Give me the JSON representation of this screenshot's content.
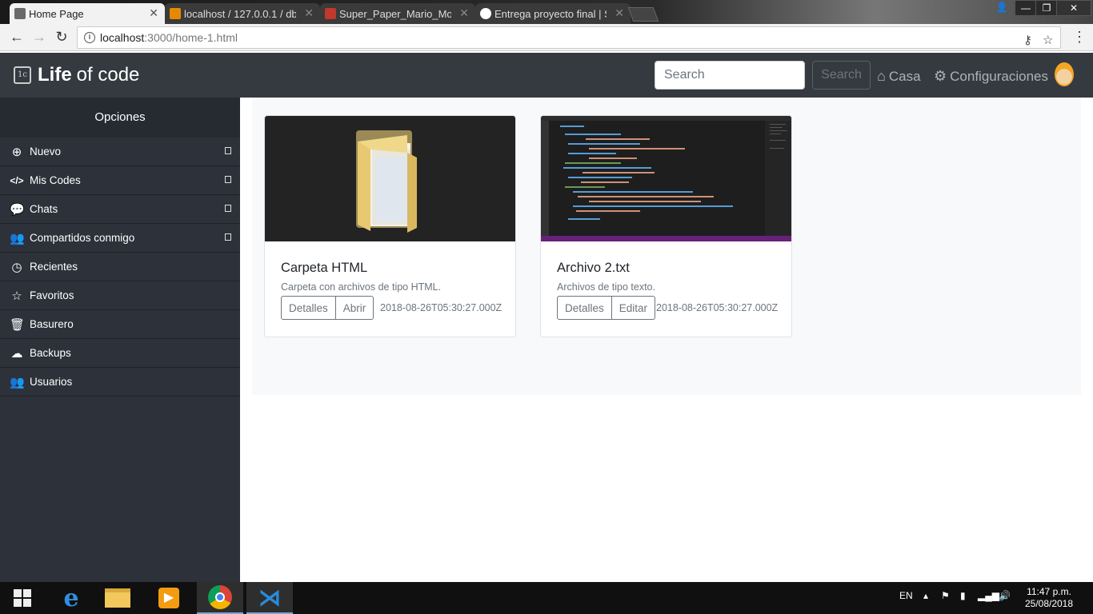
{
  "browser": {
    "tabs": [
      {
        "title": "Home Page",
        "active": true
      },
      {
        "title": "localhost / 127.0.0.1 / db",
        "active": false
      },
      {
        "title": "Super_Paper_Mario_MoP",
        "active": false
      },
      {
        "title": "Entrega proyecto final | S",
        "active": false
      }
    ],
    "url_host": "localhost",
    "url_path": ":3000/home-1.html"
  },
  "header": {
    "brand_bold": "Life",
    "brand_rest": "of code",
    "logo_text": "1c",
    "search_placeholder": "Search",
    "search_button": "Search",
    "nav_home": "Casa",
    "nav_settings": "Configuraciones"
  },
  "sidebar": {
    "title": "Opciones",
    "items": [
      {
        "label": "Nuevo",
        "icon": "plus-circle-icon",
        "expandable": true
      },
      {
        "label": "Mis Codes",
        "icon": "code-icon",
        "expandable": true
      },
      {
        "label": "Chats",
        "icon": "chat-icon",
        "expandable": true
      },
      {
        "label": "Compartidos conmigo",
        "icon": "users-icon",
        "expandable": true
      },
      {
        "label": "Recientes",
        "icon": "clock-icon",
        "expandable": false
      },
      {
        "label": "Favoritos",
        "icon": "star-icon",
        "expandable": false
      },
      {
        "label": "Basurero",
        "icon": "trash-icon",
        "expandable": false
      },
      {
        "label": "Backups",
        "icon": "cloud-upload-icon",
        "expandable": false
      },
      {
        "label": "Usuarios",
        "icon": "users-icon",
        "expandable": false
      }
    ]
  },
  "cards": [
    {
      "title": "Carpeta HTML",
      "description": "Carpeta con archivos de tipo HTML.",
      "btn1": "Detalles",
      "btn2": "Abrir",
      "date": "2018-08-26T05:30:27.000Z"
    },
    {
      "title": "Archivo 2.txt",
      "description": "Archivos de tipo texto.",
      "btn1": "Detalles",
      "btn2": "Editar",
      "date": "2018-08-26T05:30:27.000Z"
    }
  ],
  "taskbar": {
    "language": "EN",
    "time": "11:47 p.m.",
    "date": "25/08/2018"
  },
  "colors": {
    "navbar": "#343a40",
    "sidebar": "#2c313a",
    "vscode_statusbar": "#68217a"
  }
}
